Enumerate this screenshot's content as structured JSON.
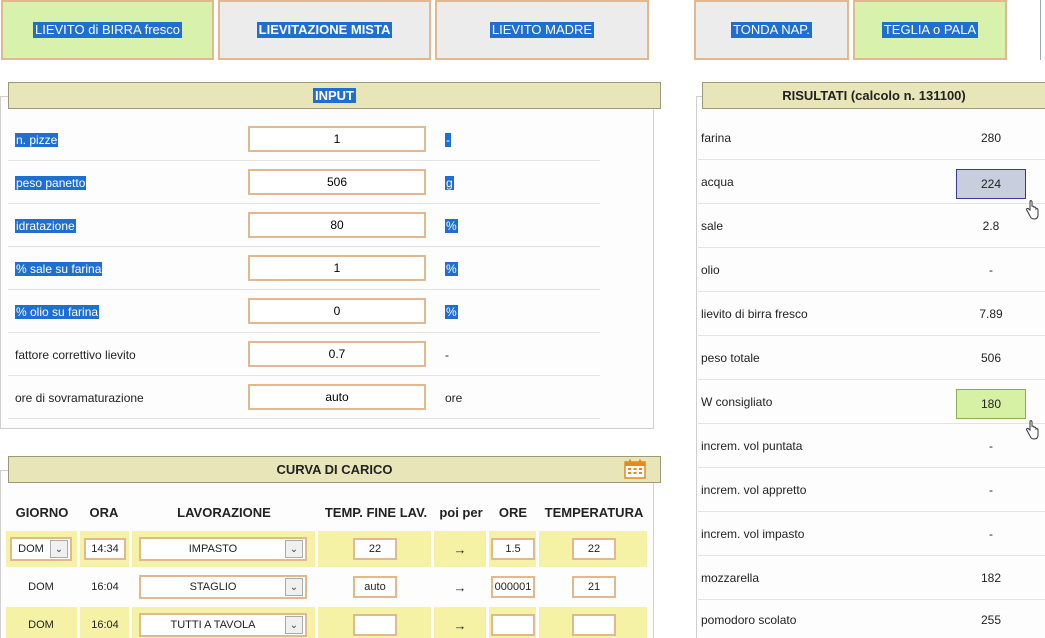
{
  "tabs": [
    {
      "label": "LIEVITO di BIRRA fresco",
      "style": "green"
    },
    {
      "label": "LIEVITAZIONE MISTA",
      "style": "grey-bold"
    },
    {
      "label": "LIEVITO MADRE",
      "style": "grey"
    },
    {
      "label": "TONDA NAP.",
      "style": "grey"
    },
    {
      "label": "TEGLIA o PALA",
      "style": "green"
    }
  ],
  "input": {
    "title": "INPUT",
    "rows": [
      {
        "label": "n. pizze",
        "value": "1",
        "unit": "-"
      },
      {
        "label": "peso panetto",
        "value": "506",
        "unit": "g"
      },
      {
        "label": "idratazione",
        "value": "80",
        "unit": "%"
      },
      {
        "label": "% sale su farina",
        "value": "1",
        "unit": "%"
      },
      {
        "label": "% olio su farina",
        "value": "0",
        "unit": "%"
      },
      {
        "label": "fattore correttivo lievito",
        "value": "0.7",
        "unit": "-"
      },
      {
        "label": "ore di sovramaturazione",
        "value": "auto",
        "unit": "ore"
      }
    ]
  },
  "results": {
    "title": "RISULTATI (calcolo n. 131100)",
    "rows": [
      {
        "label": "farina",
        "value": "280"
      },
      {
        "label": "acqua",
        "value": "224"
      },
      {
        "label": "sale",
        "value": "2.8"
      },
      {
        "label": "olio",
        "value": "-"
      },
      {
        "label": "lievito di birra fresco",
        "value": "7.89"
      },
      {
        "label": "peso totale",
        "value": "506"
      },
      {
        "label": "W consigliato",
        "value": "180"
      },
      {
        "label": "increm. vol puntata",
        "value": "-"
      },
      {
        "label": "increm. vol appretto",
        "value": "-"
      },
      {
        "label": "increm. vol impasto",
        "value": "-"
      },
      {
        "label": "mozzarella",
        "value": "182"
      },
      {
        "label": "pomodoro scolato",
        "value": "255"
      }
    ],
    "highlight_colors": {
      "acqua": "#c8cedd",
      "w_consigliato": "#d6f0a4"
    }
  },
  "curva": {
    "title": "CURVA DI CARICO",
    "headers": {
      "giorno": "GIORNO",
      "ora": "ORA",
      "lavorazione": "LAVORAZIONE",
      "temp_fine": "TEMP. FINE LAV.",
      "poi_per": "poi per",
      "ore": "ORE",
      "temperatura": "TEMPERATURA"
    },
    "rows": [
      {
        "giorno": "DOM",
        "ora": "14:34",
        "lavorazione": "IMPASTO",
        "temp_fine": "22",
        "arrow": "→",
        "ore": "1.5",
        "temperatura": "22"
      },
      {
        "giorno": "DOM",
        "ora": "16:04",
        "lavorazione": "STAGLIO",
        "temp_fine": "auto",
        "arrow": "→",
        "ore": "000001",
        "temperatura": "21"
      },
      {
        "giorno": "DOM",
        "ora": "16:04",
        "lavorazione": "TUTTI A TAVOLA",
        "temp_fine": "",
        "arrow": "→",
        "ore": "",
        "temperatura": ""
      }
    ]
  },
  "icons": {
    "calendar": "calendar-icon",
    "hand": "hand-pointer-icon",
    "dropdown": "chevron-down-icon"
  }
}
